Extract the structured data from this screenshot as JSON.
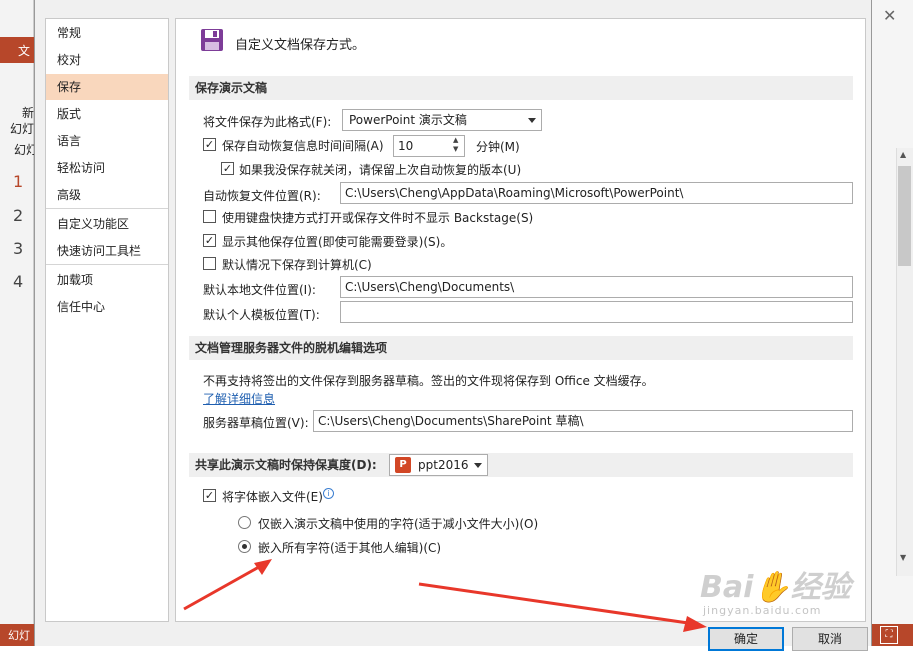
{
  "background": {
    "ribbon_tab": "文",
    "left_labels": [
      "新",
      "幻灯",
      "幻灯"
    ],
    "slide_numbers": [
      "1",
      "2",
      "3",
      "4"
    ],
    "status_text": "幻灯"
  },
  "nav": {
    "items": [
      {
        "label": "常规"
      },
      {
        "label": "校对"
      },
      {
        "label": "保存",
        "selected": true
      },
      {
        "label": "版式"
      },
      {
        "label": "语言"
      },
      {
        "label": "轻松访问"
      },
      {
        "label": "高级"
      },
      {
        "label": "自定义功能区"
      },
      {
        "label": "快速访问工具栏"
      },
      {
        "label": "加载项"
      },
      {
        "label": "信任中心"
      }
    ]
  },
  "header": {
    "icon": "save-disk-icon",
    "title": "自定义文档保存方式。"
  },
  "save_section": {
    "title": "保存演示文稿",
    "format_label": "将文件保存为此格式(F):",
    "format_value": "PowerPoint 演示文稿",
    "autorecover_label": "保存自动恢复信息时间间隔(A)",
    "autorecover_checked": true,
    "autorecover_minutes": "10",
    "minutes_label": "分钟(M)",
    "keep_last_label": "如果我没保存就关闭，请保留上次自动恢复的版本(U)",
    "keep_last_checked": true,
    "autorecover_location_label": "自动恢复文件位置(R):",
    "autorecover_location_value": "C:\\Users\\Cheng\\AppData\\Roaming\\Microsoft\\PowerPoint\\",
    "backstage_label": "使用键盘快捷方式打开或保存文件时不显示 Backstage(S)",
    "backstage_checked": false,
    "show_other_label": "显示其他保存位置(即使可能需要登录)(S)。",
    "show_other_checked": true,
    "save_to_computer_label": "默认情况下保存到计算机(C)",
    "save_to_computer_checked": false,
    "default_local_label": "默认本地文件位置(I):",
    "default_local_value": "C:\\Users\\Cheng\\Documents\\",
    "default_template_label": "默认个人模板位置(T):",
    "default_template_value": ""
  },
  "offline_section": {
    "title": "文档管理服务器文件的脱机编辑选项",
    "info_text": "不再支持将签出的文件保存到服务器草稿。签出的文件现将保存到 Office 文档缓存。",
    "learn_more": "了解详细信息",
    "drafts_label": "服务器草稿位置(V):",
    "drafts_value": "C:\\Users\\Cheng\\Documents\\SharePoint 草稿\\"
  },
  "fidelity_section": {
    "title": "共享此演示文稿时保持保真度(D):",
    "document_value": "ppt2016",
    "embed_fonts_label": "将字体嵌入文件(E)",
    "embed_fonts_checked": true,
    "embed_used_label": "仅嵌入演示文稿中使用的字符(适于减小文件大小)(O)",
    "embed_all_label": "嵌入所有字符(适于其他人编辑)(C)",
    "embed_all_selected": true
  },
  "buttons": {
    "ok": "确定",
    "cancel": "取消"
  },
  "watermark": {
    "brand": "Bai",
    "brand_cn": "经验",
    "url": "jingyan.baidu.com"
  },
  "colors": {
    "accent": "#b7472a",
    "nav_selected": "#f9d7bd",
    "arrow": "#e8372a",
    "default_button_border": "#0078d7"
  }
}
